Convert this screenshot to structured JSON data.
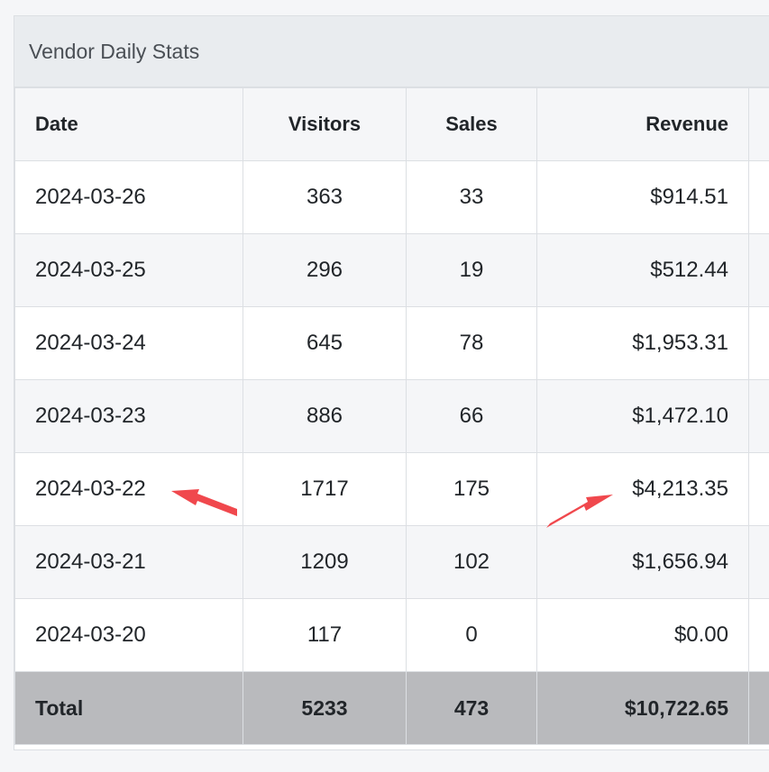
{
  "panel": {
    "title": "Vendor Daily Stats"
  },
  "table": {
    "headers": {
      "date": "Date",
      "visitors": "Visitors",
      "sales": "Sales",
      "revenue": "Revenue"
    },
    "rows": [
      {
        "date": "2024-03-26",
        "visitors": "363",
        "sales": "33",
        "revenue": "$914.51"
      },
      {
        "date": "2024-03-25",
        "visitors": "296",
        "sales": "19",
        "revenue": "$512.44"
      },
      {
        "date": "2024-03-24",
        "visitors": "645",
        "sales": "78",
        "revenue": "$1,953.31"
      },
      {
        "date": "2024-03-23",
        "visitors": "886",
        "sales": "66",
        "revenue": "$1,472.10"
      },
      {
        "date": "2024-03-22",
        "visitors": "1717",
        "sales": "175",
        "revenue": "$4,213.35"
      },
      {
        "date": "2024-03-21",
        "visitors": "1209",
        "sales": "102",
        "revenue": "$1,656.94"
      },
      {
        "date": "2024-03-20",
        "visitors": "117",
        "sales": "0",
        "revenue": "$0.00"
      }
    ],
    "total": {
      "label": "Total",
      "visitors": "5233",
      "sales": "473",
      "revenue": "$10,722.65"
    }
  },
  "annotations": {
    "arrow_color": "#f0484d",
    "highlighted_row_date": "2024-03-22"
  },
  "colors": {
    "header_bg": "#e9ecef",
    "stripe_bg": "#f5f6f8",
    "total_bg": "#b9babd",
    "border": "#dcdfe3"
  }
}
